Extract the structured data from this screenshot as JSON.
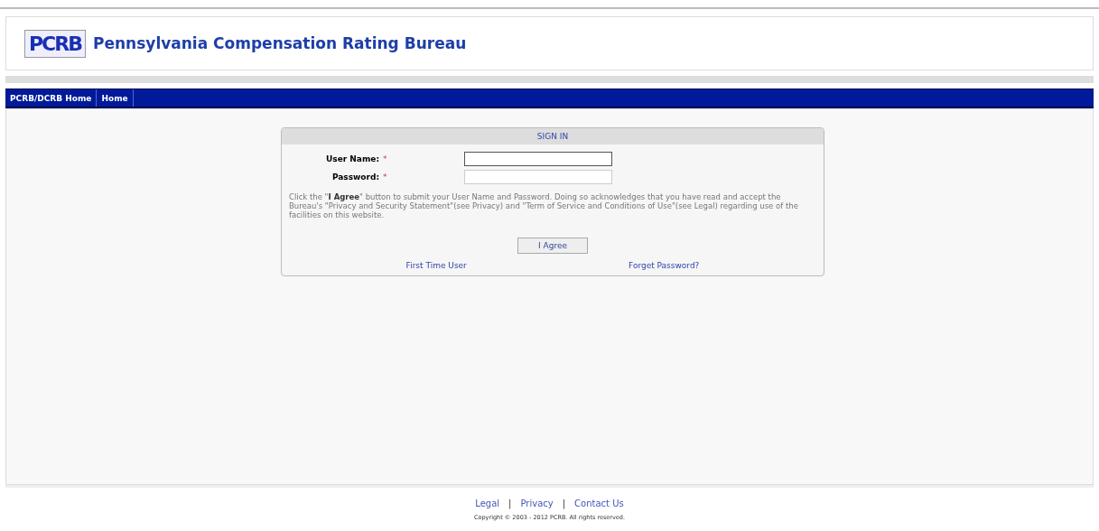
{
  "header": {
    "logo_text": "PCRB",
    "title": "Pennsylvania Compensation Rating Bureau"
  },
  "nav": [
    "PCRB/DCRB Home",
    "Home"
  ],
  "sign_in": {
    "title": "SIGN IN",
    "fields": [
      {
        "label": "User Name:",
        "required_mark": "*",
        "focused": true
      },
      {
        "label": "Password:",
        "required_mark": "*",
        "focused": false
      }
    ],
    "notice": "Click the \"**I Agree**\" button to submit your User Name and Password. Doing so acknowledges that you have read and accept the Bureau's \"Privacy and Security Statement\"(see Privacy) and \"Term of Service and Conditions of Use\"(see Legal) regarding use of the facilities on this website.",
    "button": "I Agree",
    "links": [
      "First Time User",
      "Forget Password?"
    ]
  },
  "footer": {
    "items": [
      {
        "kind": "link",
        "text": "Legal"
      },
      {
        "kind": "separator",
        "text": "|"
      },
      {
        "kind": "link",
        "text": "Privacy"
      },
      {
        "kind": "separator",
        "text": "|"
      },
      {
        "kind": "link",
        "text": "Contact Us"
      }
    ],
    "copyright": "Copyright © 2003 - 2012 PCRB. All rights reserved."
  }
}
